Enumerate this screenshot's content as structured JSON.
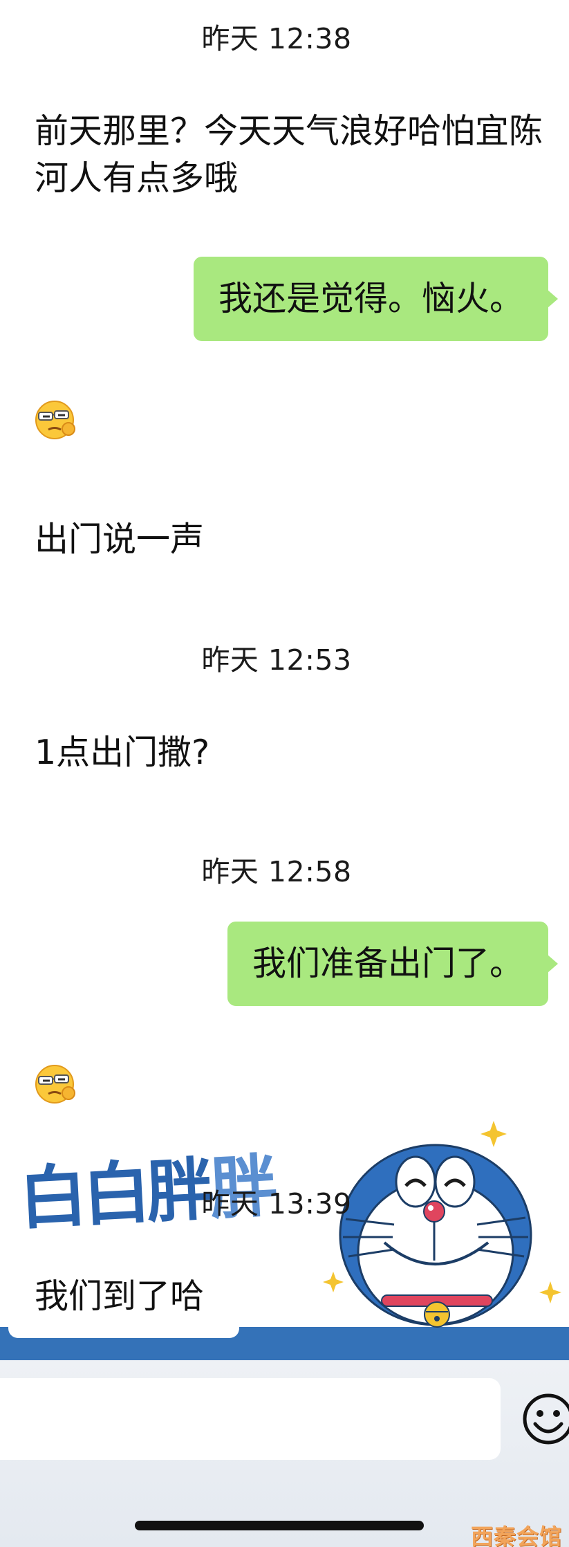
{
  "chat": {
    "ts1": "昨天 12:38",
    "msg1": "前天那里？今天天气浪好哈怕宜陈河人有点多哦",
    "sent1": "我还是觉得。恼火。",
    "msg2": "出门说一声",
    "ts2": "昨天 12:53",
    "msg3": "1点出门撒?",
    "ts3": "昨天 12:58",
    "sent2": "我们准备出门了。",
    "ts4": "昨天 13:39",
    "last": "我们到了哈"
  },
  "emoji": {
    "icon": "smirk-emoji-icon"
  },
  "sticker": {
    "title_a": "白白",
    "title_b": "胖",
    "title_c": "胖"
  },
  "input": {
    "value": "",
    "emoji_button_icon": "smiley-icon"
  },
  "watermark": "西秦会馆",
  "colors": {
    "sent_bubble": "#a9e87f",
    "sticker_blue": "#3472b8",
    "input_bg": "#eef1f5"
  }
}
